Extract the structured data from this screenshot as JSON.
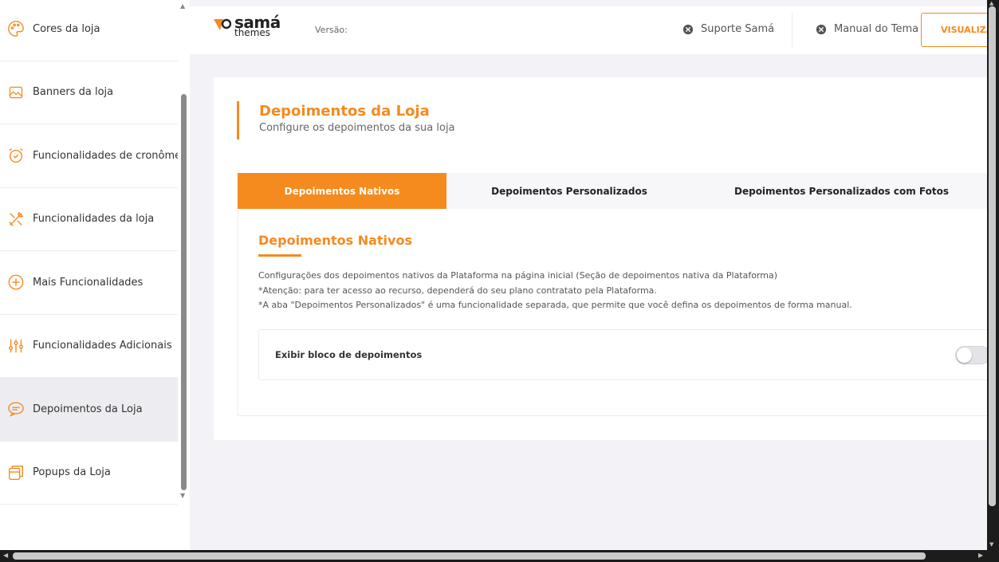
{
  "sidebar": {
    "items": [
      {
        "label": "Cores da loja",
        "icon": "palette-icon"
      },
      {
        "label": "Banners da loja",
        "icon": "image-icon"
      },
      {
        "label": "Funcionalidades de cronômetro",
        "icon": "alarm-clock-icon"
      },
      {
        "label": "Funcionalidades da loja",
        "icon": "tools-icon"
      },
      {
        "label": "Mais Funcionalidades",
        "icon": "plus-circle-icon"
      },
      {
        "label": "Funcionalidades Adicionais",
        "icon": "sliders-icon"
      },
      {
        "label": "Depoimentos da Loja",
        "icon": "chat-bubble-icon",
        "active": true
      },
      {
        "label": "Popups da Loja",
        "icon": "window-icon"
      }
    ]
  },
  "header": {
    "logo_line1": "samá",
    "logo_line2": "themes",
    "version_label": "Versão:",
    "support_link": "Suporte Samá",
    "manual_link": "Manual do Tema",
    "view_button": "VISUALIZAR"
  },
  "page": {
    "title": "Depoimentos da Loja",
    "subtitle": "Configure os depoimentos da sua loja"
  },
  "tabs": [
    {
      "label": "Depoimentos Nativos",
      "active": true
    },
    {
      "label": "Depoimentos Personalizados"
    },
    {
      "label": "Depoimentos Personalizados com Fotos"
    }
  ],
  "section": {
    "title": "Depoimentos Nativos",
    "desc_line1": "Configurações dos depoimentos nativos da Plataforma na página inicial (Seção de depoimentos nativa da Plataforma)",
    "desc_line2": "*Atenção: para ter acesso ao recurso, dependerá do seu plano contratato pela Plataforma.",
    "desc_line3": "*A aba \"Depoimentos Personalizados\" é uma funcionalidade separada, que permite que você defina os depoimentos de forma manual.",
    "setting_label": "Exibir bloco de depoimentos",
    "setting_enabled": false
  },
  "colors": {
    "accent": "#f58a1f",
    "background": "#f3f3f7"
  }
}
